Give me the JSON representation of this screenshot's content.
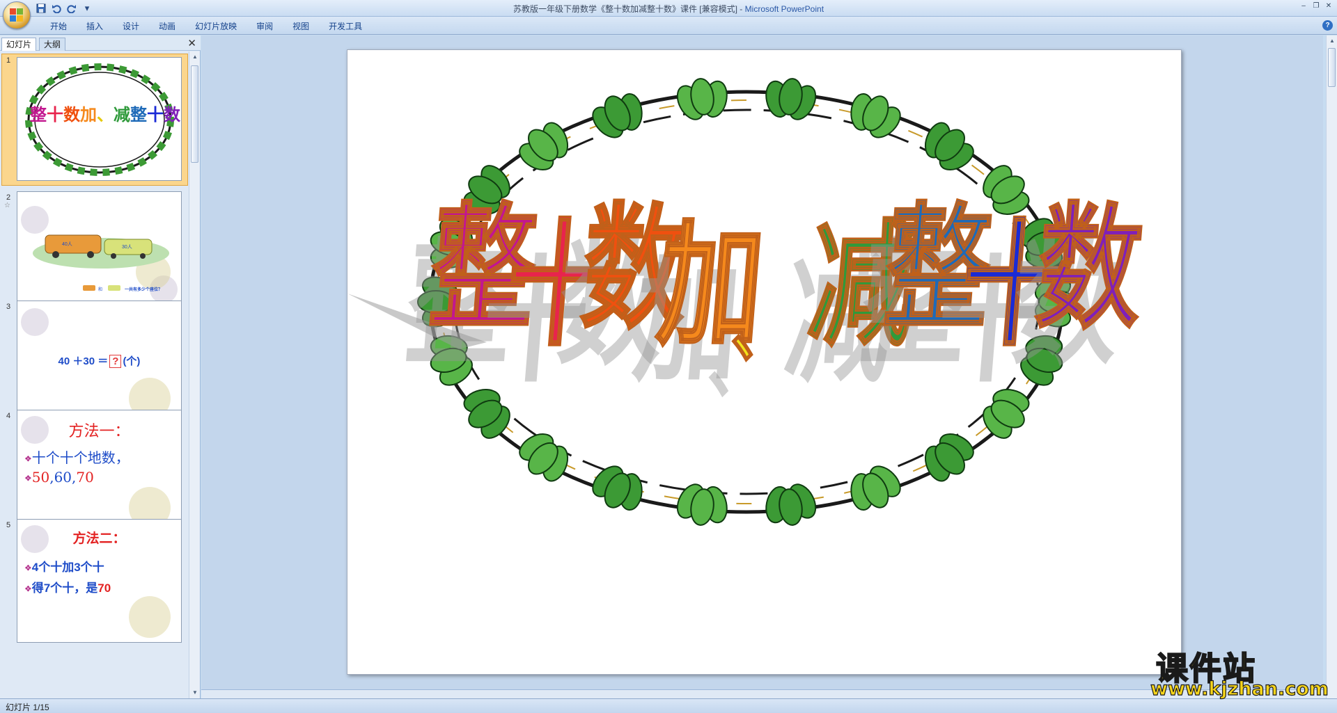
{
  "window": {
    "title": "苏教版一年级下册数学《整十数加减整十数》课件 [兼容模式] -",
    "app_name": "Microsoft PowerPoint",
    "controls": [
      "‒",
      "❐",
      "✕"
    ]
  },
  "quick_access": {
    "save_icon": "save-icon",
    "undo_icon": "undo-icon",
    "redo_icon": "redo-icon",
    "customize_icon": "dropdown-icon"
  },
  "ribbon": {
    "tabs": [
      "开始",
      "插入",
      "设计",
      "动画",
      "幻灯片放映",
      "审阅",
      "视图",
      "开发工具"
    ],
    "help_label": "?"
  },
  "panel": {
    "tabs": [
      "幻灯片",
      "大纲"
    ],
    "close_label": "✕"
  },
  "thumbnails": [
    {
      "number": "1",
      "title_chars": [
        "整",
        "十",
        "数",
        "加",
        "、",
        "减",
        "整",
        "十",
        "数"
      ]
    },
    {
      "number": "2",
      "marker": "☆",
      "bus_label_1": "40人",
      "bus_label_2": "30人",
      "caption": "一共有多少个座位？",
      "plus": "和"
    },
    {
      "number": "3",
      "eq_left": "40 ＋30 ＝",
      "eq_q": "?",
      "eq_unit": "(个)"
    },
    {
      "number": "4",
      "title": "方法一：",
      "line1": "十个十个地数，",
      "line2_a": "50",
      "line2_b": ",60,",
      "line2_c": "70"
    },
    {
      "number": "5",
      "title": "方法二：",
      "line1": "4个十加3个十",
      "line2_a": "得7个十，是",
      "line2_b": "70"
    }
  ],
  "slide": {
    "title_chars": [
      "整",
      "十",
      "数",
      "加",
      "、",
      "减",
      "整",
      "十",
      "数"
    ],
    "title_colors": [
      "#c2178f",
      "#e8244d",
      "#f0500f",
      "#f5891c",
      "#f2e31b",
      "#2f9a3b",
      "#1e6ab8",
      "#1a2ad6",
      "#8020b8"
    ]
  },
  "status": {
    "slide_counter": "幻灯片 1/15"
  },
  "watermark": {
    "text": "课件站",
    "url": "www.kjzhan.com"
  },
  "colors": {
    "ribbon_bg": "#dbe8f7",
    "accent_selection": "#f7b54c",
    "tab_text": "#15428b"
  }
}
